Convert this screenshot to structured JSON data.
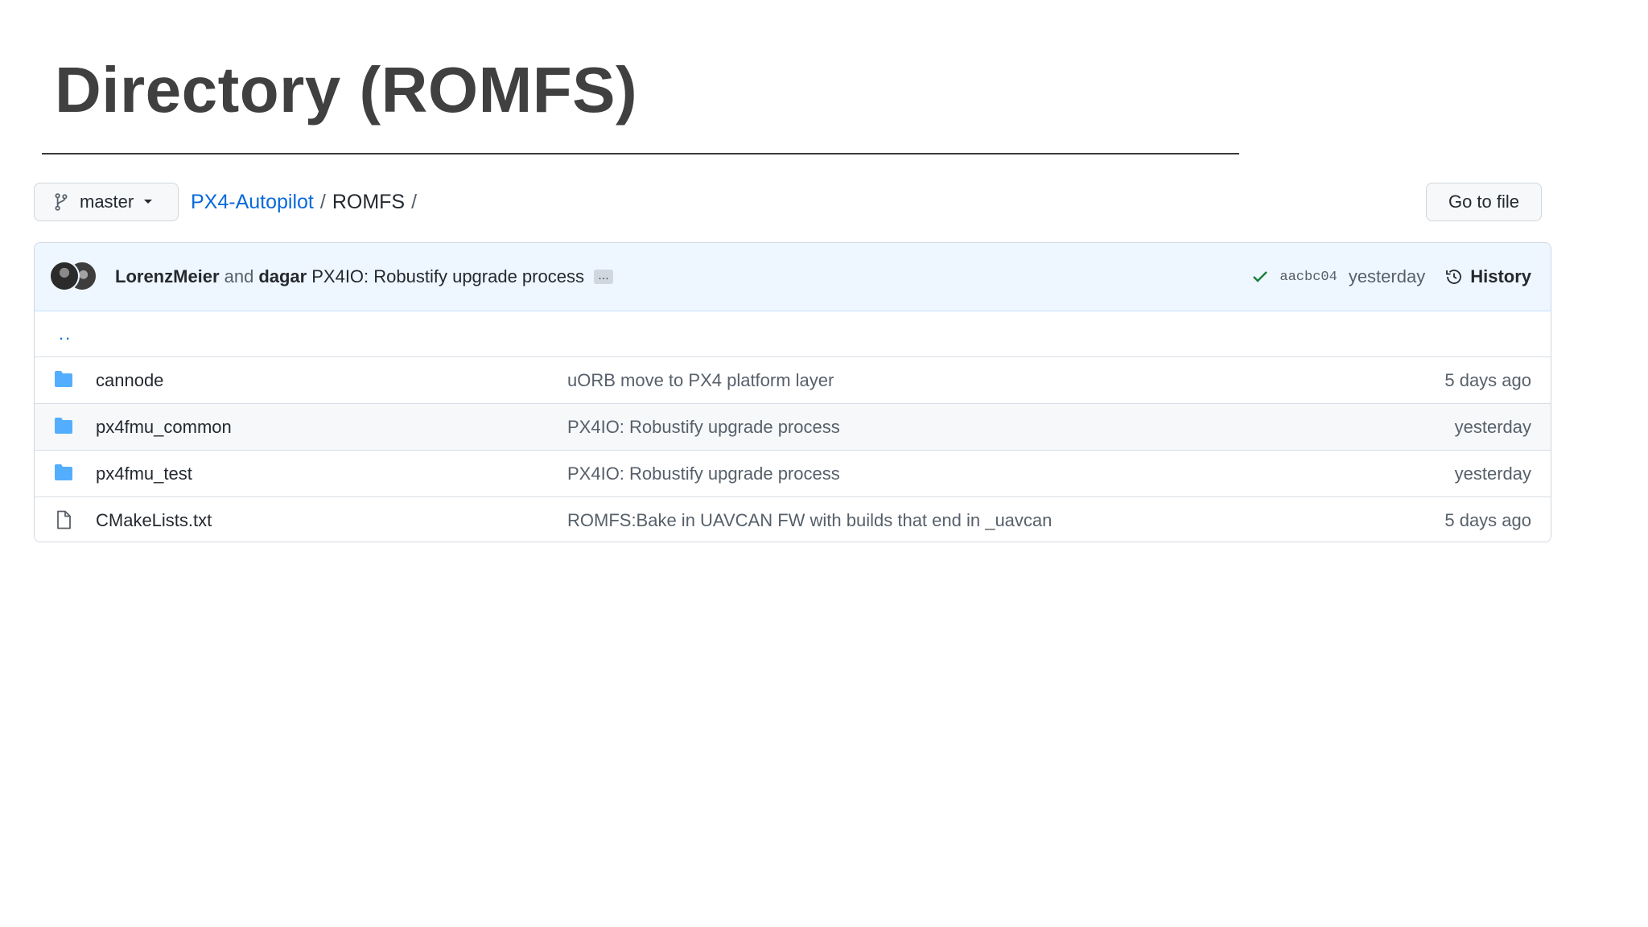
{
  "slide": {
    "title": "Directory (ROMFS)"
  },
  "toolbar": {
    "branch": "master",
    "repo_link": "PX4-Autopilot",
    "separator": "/",
    "current_dir": "ROMFS",
    "trailing_separator": "/",
    "goto_file": "Go to file"
  },
  "commit": {
    "author1": "LorenzMeier",
    "and_text": "and",
    "author2": "dagar",
    "message": "PX4IO: Robustify upgrade process",
    "ellipsis": "…",
    "sha": "aacbc04",
    "time": "yesterday",
    "history": "History"
  },
  "parent_dir": "..",
  "files": [
    {
      "type": "folder",
      "name": "cannode",
      "message": "uORB move to PX4 platform layer",
      "date": "5 days ago"
    },
    {
      "type": "folder",
      "name": "px4fmu_common",
      "message": "PX4IO: Robustify upgrade process",
      "date": "yesterday"
    },
    {
      "type": "folder",
      "name": "px4fmu_test",
      "message": "PX4IO: Robustify upgrade process",
      "date": "yesterday"
    },
    {
      "type": "file",
      "name": "CMakeLists.txt",
      "message": "ROMFS:Bake in UAVCAN FW with builds that end in _uavcan",
      "date": "5 days ago"
    }
  ],
  "colors": {
    "link": "#0969da",
    "folder_icon": "#54aeff",
    "check": "#1a7f37",
    "commit_bar_bg": "#eef6ff"
  }
}
